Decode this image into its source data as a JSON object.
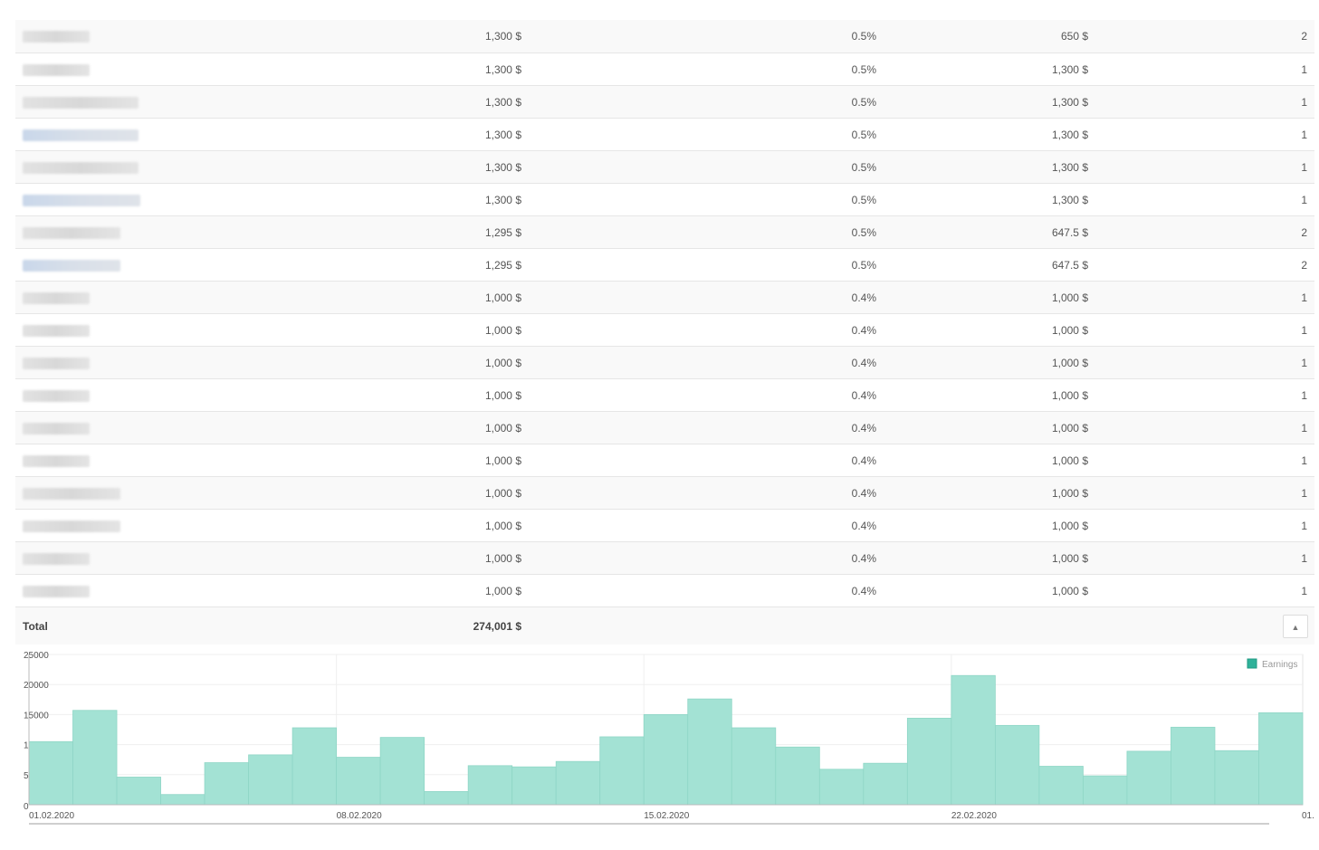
{
  "table": {
    "rows": [
      {
        "sum": "1,300 $",
        "percent": "0.5%",
        "average": "650 $",
        "count": "2",
        "name_width": 74,
        "link": false
      },
      {
        "sum": "1,300 $",
        "percent": "0.5%",
        "average": "1,300 $",
        "count": "1",
        "name_width": 74,
        "link": false
      },
      {
        "sum": "1,300 $",
        "percent": "0.5%",
        "average": "1,300 $",
        "count": "1",
        "name_width": 128,
        "link": false
      },
      {
        "sum": "1,300 $",
        "percent": "0.5%",
        "average": "1,300 $",
        "count": "1",
        "name_width": 128,
        "link": true
      },
      {
        "sum": "1,300 $",
        "percent": "0.5%",
        "average": "1,300 $",
        "count": "1",
        "name_width": 128,
        "link": false
      },
      {
        "sum": "1,300 $",
        "percent": "0.5%",
        "average": "1,300 $",
        "count": "1",
        "name_width": 130,
        "link": true
      },
      {
        "sum": "1,295 $",
        "percent": "0.5%",
        "average": "647.5 $",
        "count": "2",
        "name_width": 108,
        "link": false
      },
      {
        "sum": "1,295 $",
        "percent": "0.5%",
        "average": "647.5 $",
        "count": "2",
        "name_width": 108,
        "link": true
      },
      {
        "sum": "1,000 $",
        "percent": "0.4%",
        "average": "1,000 $",
        "count": "1",
        "name_width": 74,
        "link": false
      },
      {
        "sum": "1,000 $",
        "percent": "0.4%",
        "average": "1,000 $",
        "count": "1",
        "name_width": 74,
        "link": false
      },
      {
        "sum": "1,000 $",
        "percent": "0.4%",
        "average": "1,000 $",
        "count": "1",
        "name_width": 74,
        "link": false
      },
      {
        "sum": "1,000 $",
        "percent": "0.4%",
        "average": "1,000 $",
        "count": "1",
        "name_width": 74,
        "link": false
      },
      {
        "sum": "1,000 $",
        "percent": "0.4%",
        "average": "1,000 $",
        "count": "1",
        "name_width": 74,
        "link": false
      },
      {
        "sum": "1,000 $",
        "percent": "0.4%",
        "average": "1,000 $",
        "count": "1",
        "name_width": 74,
        "link": false
      },
      {
        "sum": "1,000 $",
        "percent": "0.4%",
        "average": "1,000 $",
        "count": "1",
        "name_width": 108,
        "link": false
      },
      {
        "sum": "1,000 $",
        "percent": "0.4%",
        "average": "1,000 $",
        "count": "1",
        "name_width": 108,
        "link": false
      },
      {
        "sum": "1,000 $",
        "percent": "0.4%",
        "average": "1,000 $",
        "count": "1",
        "name_width": 74,
        "link": false
      },
      {
        "sum": "1,000 $",
        "percent": "0.4%",
        "average": "1,000 $",
        "count": "1",
        "name_width": 74,
        "link": false
      }
    ],
    "total": {
      "label": "Total",
      "sum": "274,001 $"
    },
    "scroll_top_icon": "arrow-up-icon"
  },
  "chart_data": {
    "type": "bar",
    "series": [
      {
        "name": "Earnings",
        "color": "#a3e2d4",
        "values": [
          10500,
          15700,
          4600,
          1700,
          7000,
          8300,
          12800,
          7900,
          11200,
          2200,
          6500,
          6300,
          7200,
          11300,
          15000,
          17600,
          12800,
          9600,
          5900,
          6900,
          14400,
          21500,
          13200,
          6400,
          4800,
          8900,
          12900,
          9000,
          15300
        ]
      }
    ],
    "ylim": [
      0,
      25000
    ],
    "yticks": [
      "0",
      "5000",
      "10000",
      "15000",
      "20000",
      "25000"
    ],
    "xtick_labels": [
      "01.02.2020",
      "08.02.2020",
      "15.02.2020",
      "22.02.2020",
      "01."
    ],
    "legend": "top-right",
    "grid": true
  }
}
